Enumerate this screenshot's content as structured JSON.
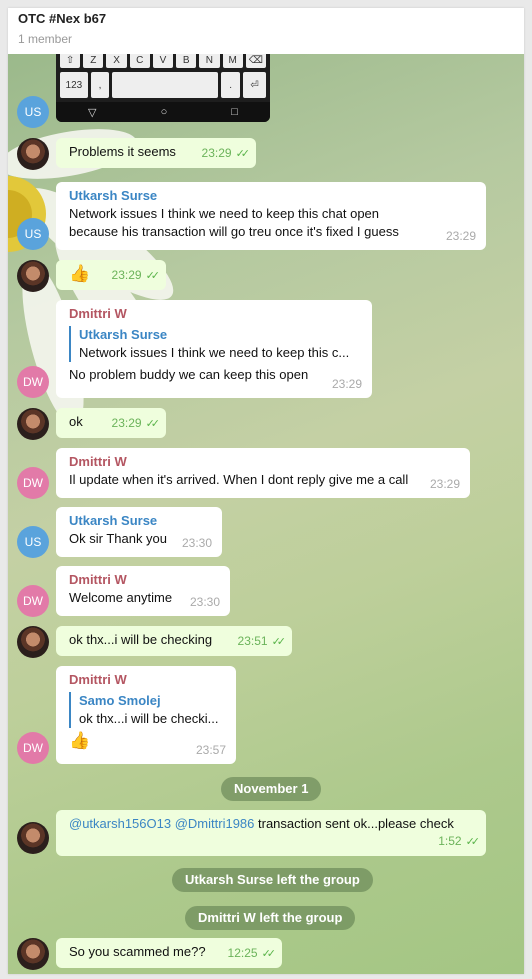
{
  "header": {
    "title": "OTC #Nex b67",
    "subtitle": "1 member"
  },
  "keyboard": {
    "row1": [
      "Z",
      "X",
      "C",
      "V",
      "B",
      "N",
      "M"
    ],
    "num_key": "123",
    "nav": [
      "▽",
      "○",
      "□"
    ]
  },
  "messages": {
    "m1": {
      "text": "Problems it seems",
      "time": "23:29"
    },
    "m2": {
      "sender": "Utkarsh Surse",
      "text": "Network issues I think we need to keep this chat open because his transaction will go treu once it's fixed I guess",
      "time": "23:29"
    },
    "m3": {
      "time": "23:29"
    },
    "m4": {
      "sender": "Dmittri W",
      "quote_name": "Utkarsh Surse",
      "quote_text": "Network issues I think we need to keep this c...",
      "text": "No problem buddy we can keep this open",
      "time": "23:29"
    },
    "m5": {
      "text": "ok",
      "time": "23:29"
    },
    "m6": {
      "sender": "Dmittri W",
      "text": "Il update when it's arrived. When I dont reply give me a call",
      "time": "23:29"
    },
    "m7": {
      "sender": "Utkarsh Surse",
      "text": "Ok sir Thank you",
      "time": "23:30"
    },
    "m8": {
      "sender": "Dmittri W",
      "text": "Welcome anytime",
      "time": "23:30"
    },
    "m9": {
      "text": "ok thx...i will be checking",
      "time": "23:51"
    },
    "m10": {
      "sender": "Dmittri W",
      "quote_name": "Samo Smolej",
      "quote_text": "ok thx...i will be checki...",
      "time": "23:57"
    },
    "m11": {
      "mention1": "@utkarsh156O13",
      "mention2": "@Dmittri1986",
      "text": " transaction sent ok...please check",
      "time": "1:52"
    },
    "m12": {
      "text": "So you scammed me??",
      "time": "12:25"
    }
  },
  "service": {
    "date": "November 1",
    "left1": "Utkarsh Surse left the group",
    "left2": "Dmittri W left the group"
  },
  "avatars": {
    "us": "US",
    "dw": "DW"
  },
  "colors": {
    "outgoing_bubble": "#effedd",
    "incoming_bubble": "#ffffff",
    "sender_blue": "#3b86c4",
    "sender_red": "#b45662",
    "check_green": "#5ab44a"
  }
}
